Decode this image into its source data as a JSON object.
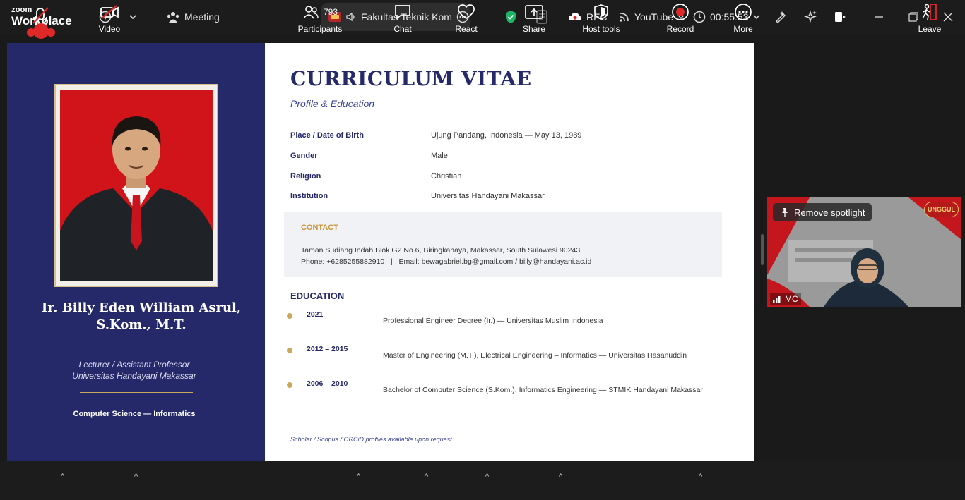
{
  "topbar": {
    "brand_small": "zoom",
    "brand_big": "Workplace",
    "meeting_label": "Meeting",
    "tab_label": "Fakultas Teknik Kom",
    "rec_label": "REC",
    "youtube_label": "YouTube",
    "timer": "00:55:53"
  },
  "slide": {
    "name_line1": "Ir. Billy Eden William Asrul,",
    "name_line2": "S.Kom., M.T.",
    "role_line1": "Lecturer / Assistant Professor",
    "role_line2": "Universitas Handayani Makassar",
    "dept": "Computer Science — Informatics",
    "title": "CURRICULUM VITAE",
    "subtitle": "Profile & Education",
    "info": [
      {
        "label": "Place / Date of Birth",
        "value": "Ujung Pandang, Indonesia — May 13, 1989"
      },
      {
        "label": "Gender",
        "value": "Male"
      },
      {
        "label": "Religion",
        "value": "Christian"
      },
      {
        "label": "Institution",
        "value": "Universitas Handayani Makassar"
      }
    ],
    "contact": {
      "heading": "CONTACT",
      "address": "Taman Sudiang Indah Blok G2 No.6, Biringkanaya, Makassar, South Sulawesi 90243",
      "phone_email": "Phone: +6285255882910   |   Email: bewagabriel.bg@gmail.com / billy@handayani.ac.id"
    },
    "education_heading": "EDUCATION",
    "education": [
      {
        "year": "2021",
        "desc": "Professional Engineer Degree (Ir.)  —  Universitas Muslim Indonesia"
      },
      {
        "year": "2012 – 2015",
        "desc": "Master of Engineering (M.T.), Electrical Engineering – Informatics  —  Universitas Hasanuddin"
      },
      {
        "year": "2006 – 2010",
        "desc": "Bachelor of Computer Science (S.Kom.), Informatics Engineering  —  STMIK Handayani Makassar"
      }
    ],
    "footnote": "Scholar / Scopus / ORCiD profiles available upon request"
  },
  "video": {
    "spotlight_label": "Remove spotlight",
    "participant_name": "MC",
    "badge": "UNGGUL"
  },
  "toolbar": {
    "video": "Video",
    "participants": "Participants",
    "participant_count": "793",
    "chat": "Chat",
    "react": "React",
    "share": "Share",
    "host_tools": "Host tools",
    "record": "Record",
    "more": "More",
    "leave": "Leave"
  },
  "colors": {
    "navy": "#25296a",
    "gold": "#c9a85c",
    "record_red": "#e02828",
    "secure_green": "#1fb464"
  }
}
